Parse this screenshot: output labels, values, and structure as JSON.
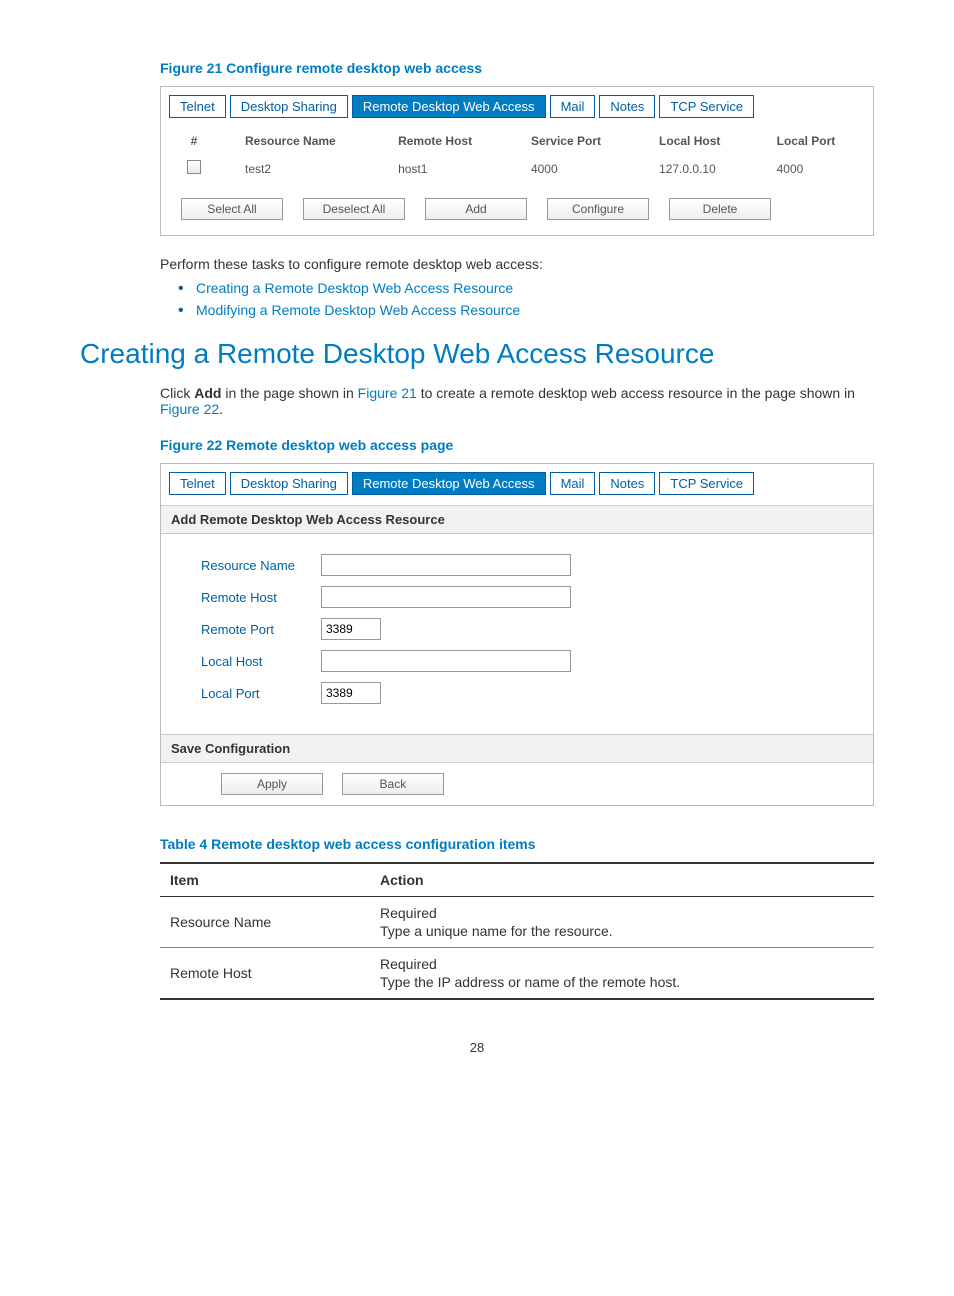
{
  "figure21": {
    "caption": "Figure 21 Configure remote desktop web access",
    "tabs": [
      "Telnet",
      "Desktop Sharing",
      "Remote Desktop Web Access",
      "Mail",
      "Notes",
      "TCP Service"
    ],
    "active_tab_index": 2,
    "headers": [
      "#",
      "Resource Name",
      "Remote Host",
      "Service Port",
      "Local Host",
      "Local Port"
    ],
    "row": {
      "resource_name": "test2",
      "remote_host": "host1",
      "service_port": "4000",
      "local_host": "127.0.0.10",
      "local_port": "4000"
    },
    "buttons": [
      "Select All",
      "Deselect All",
      "Add",
      "Configure",
      "Delete"
    ]
  },
  "intro_text": "Perform these tasks to configure remote desktop web access:",
  "links": [
    "Creating a Remote Desktop Web Access Resource",
    "Modifying a Remote Desktop Web Access Resource"
  ],
  "heading": "Creating a Remote Desktop Web Access Resource",
  "para": {
    "pre": "Click ",
    "bold": "Add",
    "mid": " in the page shown in ",
    "link1": "Figure 21",
    "mid2": " to create a remote desktop web access resource in the page shown in ",
    "link2": "Figure 22",
    "end": "."
  },
  "figure22": {
    "caption": "Figure 22 Remote desktop web access page",
    "tabs": [
      "Telnet",
      "Desktop Sharing",
      "Remote Desktop Web Access",
      "Mail",
      "Notes",
      "TCP Service"
    ],
    "section_add": "Add Remote Desktop Web Access Resource",
    "fields": {
      "resource_name": {
        "label": "Resource Name",
        "value": ""
      },
      "remote_host": {
        "label": "Remote Host",
        "value": ""
      },
      "remote_port": {
        "label": "Remote Port",
        "value": "3389"
      },
      "local_host": {
        "label": "Local Host",
        "value": ""
      },
      "local_port": {
        "label": "Local Port",
        "value": "3389"
      }
    },
    "section_save": "Save Configuration",
    "buttons": [
      "Apply",
      "Back"
    ]
  },
  "table4": {
    "caption": "Table 4 Remote desktop web access configuration items",
    "headers": [
      "Item",
      "Action"
    ],
    "rows": [
      {
        "item": "Resource Name",
        "req": "Required",
        "desc": "Type a unique name for the resource."
      },
      {
        "item": "Remote Host",
        "req": "Required",
        "desc": "Type the IP address or name of the remote host."
      }
    ]
  },
  "page_number": "28"
}
